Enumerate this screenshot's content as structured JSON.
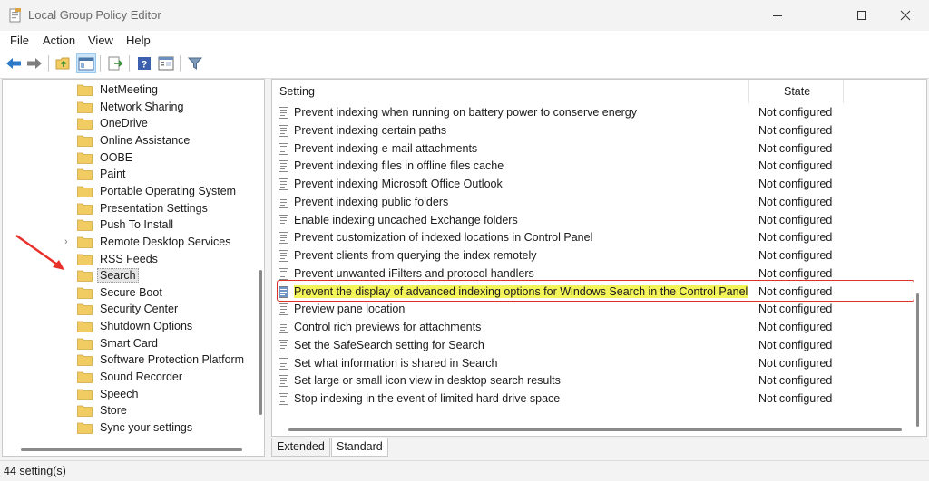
{
  "window": {
    "title": "Local Group Policy Editor"
  },
  "menu": [
    "File",
    "Action",
    "View",
    "Help"
  ],
  "toolbar": [
    "back-icon",
    "forward-icon",
    "up-folder-icon",
    "show-hide-tree-icon",
    "export-list-icon",
    "help-icon",
    "properties-icon",
    "filter-icon"
  ],
  "tree": {
    "selected": "Search",
    "items": [
      {
        "label": "NetMeeting"
      },
      {
        "label": "Network Sharing"
      },
      {
        "label": "OneDrive"
      },
      {
        "label": "Online Assistance"
      },
      {
        "label": "OOBE"
      },
      {
        "label": "Paint"
      },
      {
        "label": "Portable Operating System"
      },
      {
        "label": "Presentation Settings"
      },
      {
        "label": "Push To Install"
      },
      {
        "label": "Remote Desktop Services",
        "expandable": true
      },
      {
        "label": "RSS Feeds"
      },
      {
        "label": "Search"
      },
      {
        "label": "Secure Boot"
      },
      {
        "label": "Security Center"
      },
      {
        "label": "Shutdown Options"
      },
      {
        "label": "Smart Card"
      },
      {
        "label": "Software Protection Platform"
      },
      {
        "label": "Sound Recorder"
      },
      {
        "label": "Speech"
      },
      {
        "label": "Store"
      },
      {
        "label": "Sync your settings"
      }
    ]
  },
  "list": {
    "headers": {
      "setting": "Setting",
      "state": "State"
    },
    "rows": [
      {
        "name": "Prevent indexing when running on battery power to conserve energy",
        "state": "Not configured"
      },
      {
        "name": "Prevent indexing certain paths",
        "state": "Not configured"
      },
      {
        "name": "Prevent indexing e-mail attachments",
        "state": "Not configured"
      },
      {
        "name": "Prevent indexing files in offline files cache",
        "state": "Not configured"
      },
      {
        "name": "Prevent indexing Microsoft Office Outlook",
        "state": "Not configured"
      },
      {
        "name": "Prevent indexing public folders",
        "state": "Not configured"
      },
      {
        "name": "Enable indexing uncached Exchange folders",
        "state": "Not configured"
      },
      {
        "name": "Prevent customization of indexed locations in Control Panel",
        "state": "Not configured"
      },
      {
        "name": "Prevent clients from querying the index remotely",
        "state": "Not configured"
      },
      {
        "name": "Prevent unwanted iFilters and protocol handlers",
        "state": "Not configured"
      },
      {
        "name": "Prevent the display of advanced indexing options for Windows Search in the Control Panel",
        "state": "Not configured",
        "selected": true
      },
      {
        "name": "Preview pane location",
        "state": "Not configured"
      },
      {
        "name": "Control rich previews for attachments",
        "state": "Not configured"
      },
      {
        "name": "Set the SafeSearch setting for Search",
        "state": "Not configured"
      },
      {
        "name": "Set what information is shared in Search",
        "state": "Not configured"
      },
      {
        "name": "Set large or small icon view in desktop search results",
        "state": "Not configured"
      },
      {
        "name": "Stop indexing in the event of limited hard drive space",
        "state": "Not configured"
      }
    ]
  },
  "tabs": [
    "Extended",
    "Standard"
  ],
  "status": "44 setting(s)",
  "colors": {
    "highlight": "#f3f35a",
    "annotation": "#e0302a",
    "folder": "#f1cc63"
  }
}
